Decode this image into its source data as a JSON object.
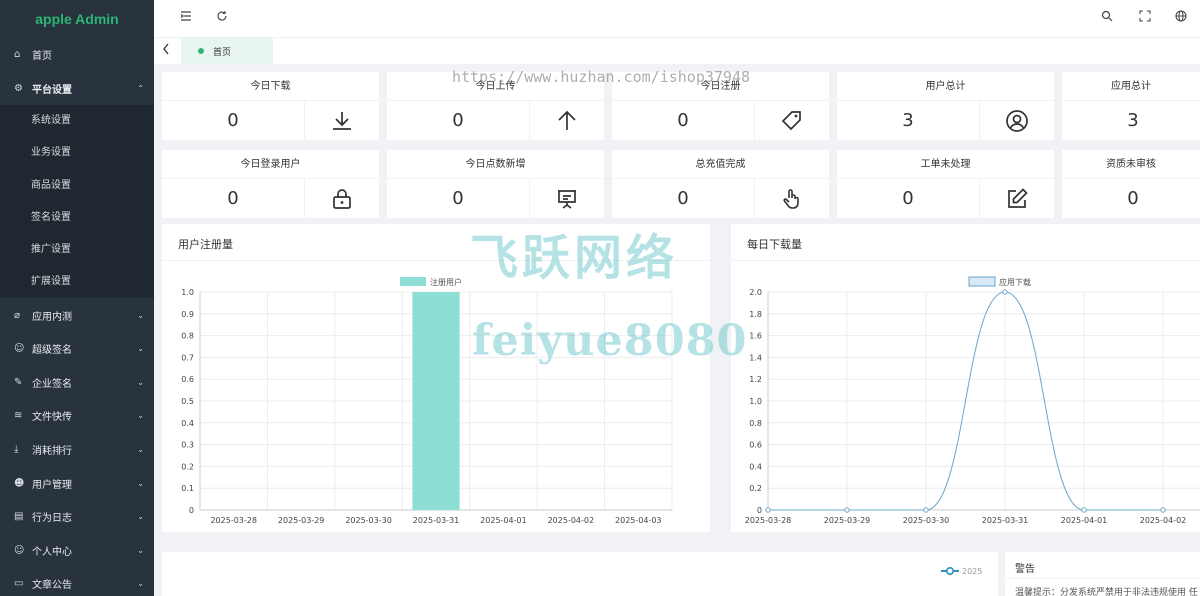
{
  "app": {
    "title": "apple Admin"
  },
  "sidebar": {
    "items": [
      {
        "label": "首页",
        "icon": "home-icon",
        "glyph": "⌂",
        "arrow": ""
      },
      {
        "label": "平台设置",
        "icon": "gear-icon",
        "glyph": "⚙",
        "arrow": "⌃"
      },
      {
        "label": "应用内测",
        "icon": "paperclip-icon",
        "glyph": "⌀",
        "arrow": "⌄"
      },
      {
        "label": "超级签名",
        "icon": "smile-icon",
        "glyph": "☺",
        "arrow": "⌄"
      },
      {
        "label": "企业签名",
        "icon": "edit-icon",
        "glyph": "✎",
        "arrow": "⌄"
      },
      {
        "label": "文件快传",
        "icon": "stack-icon",
        "glyph": "≋",
        "arrow": "⌄"
      },
      {
        "label": "消耗排行",
        "icon": "download-icon",
        "glyph": "⤓",
        "arrow": "⌄"
      },
      {
        "label": "用户管理",
        "icon": "user-circle-icon",
        "glyph": "☻",
        "arrow": "⌄"
      },
      {
        "label": "行为日志",
        "icon": "document-icon",
        "glyph": "▤",
        "arrow": "⌄"
      },
      {
        "label": "个人中心",
        "icon": "face-icon",
        "glyph": "☺",
        "arrow": "⌄"
      },
      {
        "label": "文章公告",
        "icon": "monitor-icon",
        "glyph": "▭",
        "arrow": "⌄"
      }
    ],
    "submenu": [
      "系统设置",
      "业务设置",
      "商品设置",
      "签名设置",
      "推广设置",
      "扩展设置"
    ]
  },
  "tabs": [
    {
      "label": "首页"
    }
  ],
  "stats": [
    {
      "label": "今日下载",
      "value": "0",
      "icon": "download-icon"
    },
    {
      "label": "今日上传",
      "value": "0",
      "icon": "arrow-up-icon"
    },
    {
      "label": "今日注册",
      "value": "0",
      "icon": "tag-icon"
    },
    {
      "label": "用户总计",
      "value": "3",
      "icon": "user-icon"
    },
    {
      "label": "应用总计",
      "value": "3",
      "icon": ""
    },
    {
      "label": "今日登录用户",
      "value": "0",
      "icon": "lock-icon"
    },
    {
      "label": "今日点数新增",
      "value": "0",
      "icon": "presentation-icon"
    },
    {
      "label": "总充值完成",
      "value": "0",
      "icon": "pointer-hand-icon"
    },
    {
      "label": "工单未处理",
      "value": "0",
      "icon": "edit-square-icon"
    },
    {
      "label": "资质未审核",
      "value": "0",
      "icon": ""
    }
  ],
  "chart_data": [
    {
      "type": "bar",
      "title": "用户注册量",
      "categories": [
        "2025-03-28",
        "2025-03-29",
        "2025-03-30",
        "2025-03-31",
        "2025-04-01",
        "2025-04-02",
        "2025-04-03"
      ],
      "series": [
        {
          "name": "注册用户",
          "values": [
            0,
            0,
            0,
            1,
            0,
            0,
            0
          ]
        }
      ],
      "ylim": [
        0,
        1.0
      ],
      "yticks": [
        "0",
        "0.1",
        "0.2",
        "0.3",
        "0.4",
        "0.5",
        "0.6",
        "0.7",
        "0.8",
        "0.9",
        "1.0"
      ],
      "legend": "top-center",
      "color": "#8ddfd6",
      "grid": true
    },
    {
      "type": "line",
      "title": "每日下载量",
      "categories": [
        "2025-03-28",
        "2025-03-29",
        "2025-03-30",
        "2025-03-31",
        "2025-04-01",
        "2025-04-02"
      ],
      "series": [
        {
          "name": "应用下载",
          "values": [
            0,
            0,
            0,
            2,
            0,
            0
          ]
        }
      ],
      "ylim": [
        0,
        2.0
      ],
      "yticks": [
        "0",
        "0.2",
        "0.4",
        "0.6",
        "0.8",
        "1.0",
        "1.2",
        "1.4",
        "1.6",
        "1.8",
        "2.0"
      ],
      "legend": "top-center",
      "color": "#6aa7c9",
      "grid": true
    }
  ],
  "bottom": {
    "legend_label": "2025",
    "warning_title": "警告",
    "warning_text": "温馨提示：分发系统严禁用于非法违规使用 任"
  },
  "watermarks": {
    "url": "https://www.huzhan.com/ishop37948",
    "cn": "飞跃网络",
    "en": "feiyue8080"
  }
}
